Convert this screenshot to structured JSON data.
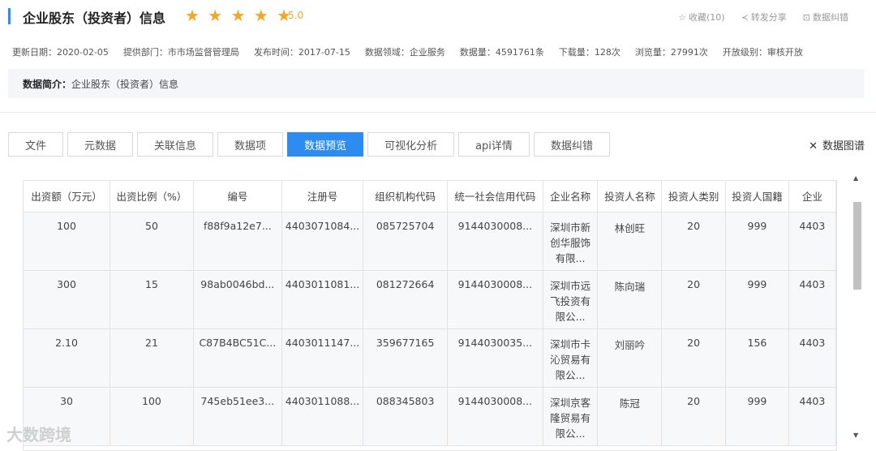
{
  "header": {
    "title": "企业股东（投资者）信息",
    "stars": "★ ★ ★ ★ ★",
    "rating": "5.0",
    "actions": [
      {
        "icon": "☆",
        "label": "收藏(10)"
      },
      {
        "icon": "≺",
        "label": "转发分享"
      },
      {
        "icon": "⊡",
        "label": "数据纠错"
      }
    ]
  },
  "meta": [
    "更新日期：2020-02-05",
    "提供部门：市市场监督管理局",
    "发布时间：2017-07-15",
    "数据领域：企业服务",
    "数据量：4591761条",
    "下载量：128次",
    "浏览量：27991次",
    "开放级别：审核开放"
  ],
  "summary": {
    "label": "数据简介：",
    "text": "企业股东（投资者）信息"
  },
  "tabs": [
    "文件",
    "元数据",
    "关联信息",
    "数据项",
    "数据预览",
    "可视化分析",
    "api详情",
    "数据纠错"
  ],
  "active_tab": "数据预览",
  "datamap": {
    "icon": "✕",
    "label": "数据图谱"
  },
  "table": {
    "columns": [
      "出资额（万元）",
      "出资比例（%）",
      "编号",
      "注册号",
      "组织机构代码",
      "统一社会信用代码",
      "企业名称",
      "投资人名称",
      "投资人类别",
      "投资人国籍",
      "企业"
    ],
    "rows": [
      [
        "100",
        "50",
        "f88f9a12e7...",
        "4403071084...",
        "085725704",
        "9144030008...",
        "深圳市新创华服饰有限...",
        "林创旺",
        "20",
        "999",
        "4403"
      ],
      [
        "300",
        "15",
        "98ab0046bd...",
        "4403011081...",
        "081272664",
        "9144030008...",
        "深圳市远飞投资有限公...",
        "陈向瑞",
        "20",
        "999",
        "4403"
      ],
      [
        "2.10",
        "21",
        "C87B4BC51C...",
        "4403011147...",
        "359677165",
        "9144030035...",
        "深圳市卡沁贸易有限公...",
        "刘丽吟",
        "20",
        "156",
        "4403"
      ],
      [
        "30",
        "100",
        "745eb51ee3...",
        "4403011088...",
        "088345803",
        "9144030008...",
        "深圳京客隆贸易有限公...",
        "陈冠",
        "20",
        "999",
        "4403"
      ]
    ]
  },
  "watermark": "大数跨境",
  "colors": {
    "accent": "#2d8cf0",
    "star": "#f5a623"
  }
}
